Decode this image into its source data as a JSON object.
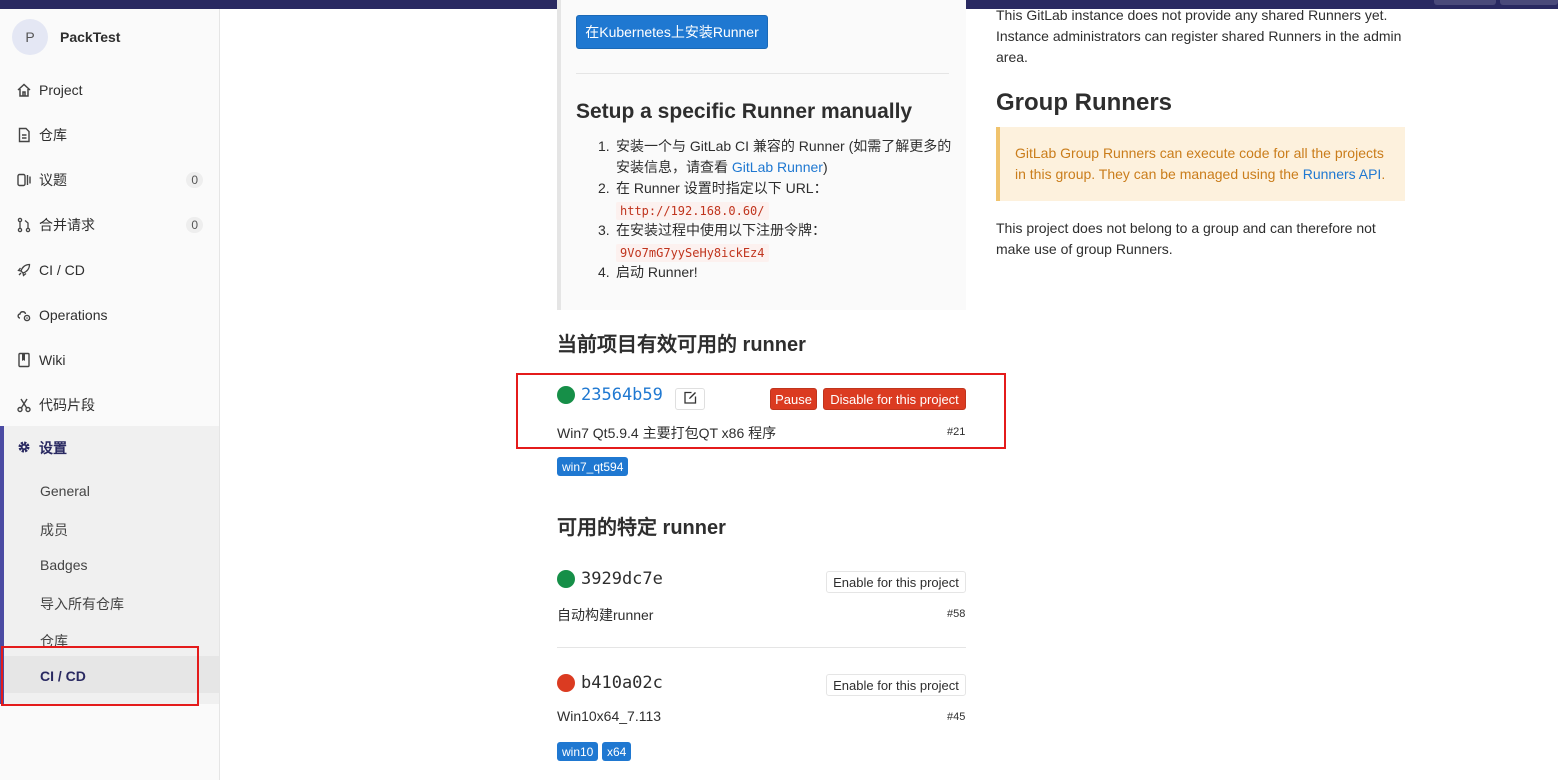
{
  "sidebar": {
    "project_initial": "P",
    "project_name": "PackTest",
    "items": [
      {
        "label": "Project",
        "icon": "home-icon"
      },
      {
        "label": "仓库",
        "icon": "doc-icon"
      },
      {
        "label": "议题",
        "icon": "issues-icon",
        "count": "0"
      },
      {
        "label": "合并请求",
        "icon": "merge-request-icon",
        "count": "0"
      },
      {
        "label": "CI / CD",
        "icon": "rocket-icon"
      },
      {
        "label": "Operations",
        "icon": "cloud-gear-icon"
      },
      {
        "label": "Wiki",
        "icon": "book-icon"
      },
      {
        "label": "代码片段",
        "icon": "scissors-icon"
      }
    ],
    "settings": {
      "label": "设置",
      "subitems": [
        "General",
        "成员",
        "Badges",
        "导入所有仓库",
        "仓库",
        "CI / CD"
      ]
    }
  },
  "main": {
    "k8s_button": "在Kubernetes上安装Runner",
    "setup_title": "Setup a specific Runner manually",
    "steps": {
      "s1_pre": "安装一个与 GitLab CI 兼容的 Runner (如需了解更多的安装信息，请查看 ",
      "s1_link": "GitLab Runner",
      "s1_post": ")",
      "s2": "在 Runner 设置时指定以下 URL：",
      "s2_code": "http://192.168.0.60/",
      "s3": "在安装过程中使用以下注册令牌：",
      "s3_code": "9Vo7mG7yySeHy8ickEz4",
      "s4": "启动 Runner!"
    },
    "active_title": "当前项目有效可用的 runner",
    "active_runner": {
      "id": "23564b59",
      "status": "green",
      "pause_label": "Pause",
      "disable_label": "Disable for this project",
      "description": "Win7 Qt5.9.4 主要打包QT x86 程序",
      "number": "#21",
      "tags": [
        "win7_qt594"
      ]
    },
    "available_title": "可用的特定 runner",
    "available_runners": [
      {
        "id": "3929dc7e",
        "status": "green",
        "enable_label": "Enable for this project",
        "description": "自动构建runner",
        "number": "#58"
      },
      {
        "id": "b410a02c",
        "status": "red",
        "enable_label": "Enable for this project",
        "description": "Win10x64_7.113",
        "number": "#45",
        "tags": [
          "win10",
          "x64"
        ]
      }
    ]
  },
  "right": {
    "shared_text": "This GitLab instance does not provide any shared Runners yet. Instance administrators can register shared Runners in the admin area.",
    "group_title": "Group Runners",
    "warn_pre": "GitLab Group Runners can execute code for all the projects in this group. They can be managed using the ",
    "warn_link": "Runners API",
    "warn_post": ".",
    "group_note": "This project does not belong to a group and can therefore not make use of group Runners."
  },
  "colors": {
    "brand": "#292961",
    "primary": "#1f78d1",
    "danger": "#db3b21",
    "success": "#168f48",
    "highlight_box": "#e41b1b"
  }
}
